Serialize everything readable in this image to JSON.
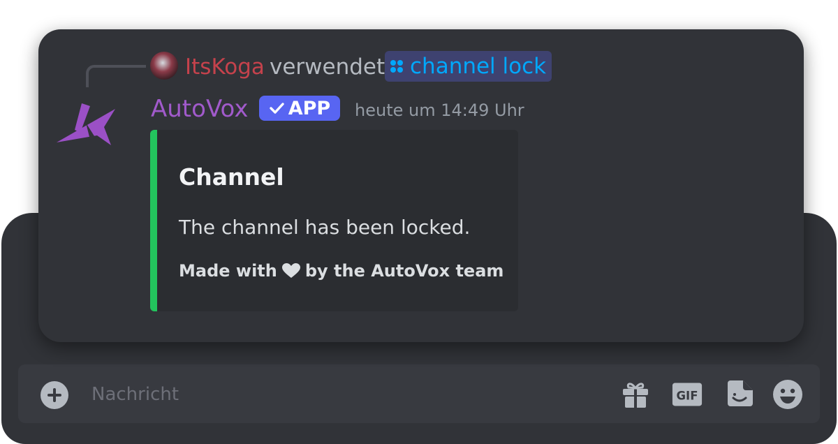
{
  "reply": {
    "username": "ItsKoga",
    "action": "verwendet",
    "command": "channel lock"
  },
  "message": {
    "author": "AutoVox",
    "badge": "APP",
    "timestamp": "heute um 14:49 Uhr"
  },
  "embed": {
    "title": "Channel",
    "description": "The channel has been locked.",
    "footer_before": "Made with",
    "footer_after": "by the AutoVox team",
    "accent_color": "#23c45d"
  },
  "composer": {
    "placeholder": "Nachricht",
    "icons": [
      "plus-icon",
      "gift-icon",
      "gif-icon",
      "sticker-icon",
      "emoji-icon"
    ]
  },
  "colors": {
    "background": "#313338",
    "username_reply": "#c5424c",
    "bot_name": "#a15acb",
    "command_link": "#00a8fc",
    "app_badge": "#5865f2"
  }
}
